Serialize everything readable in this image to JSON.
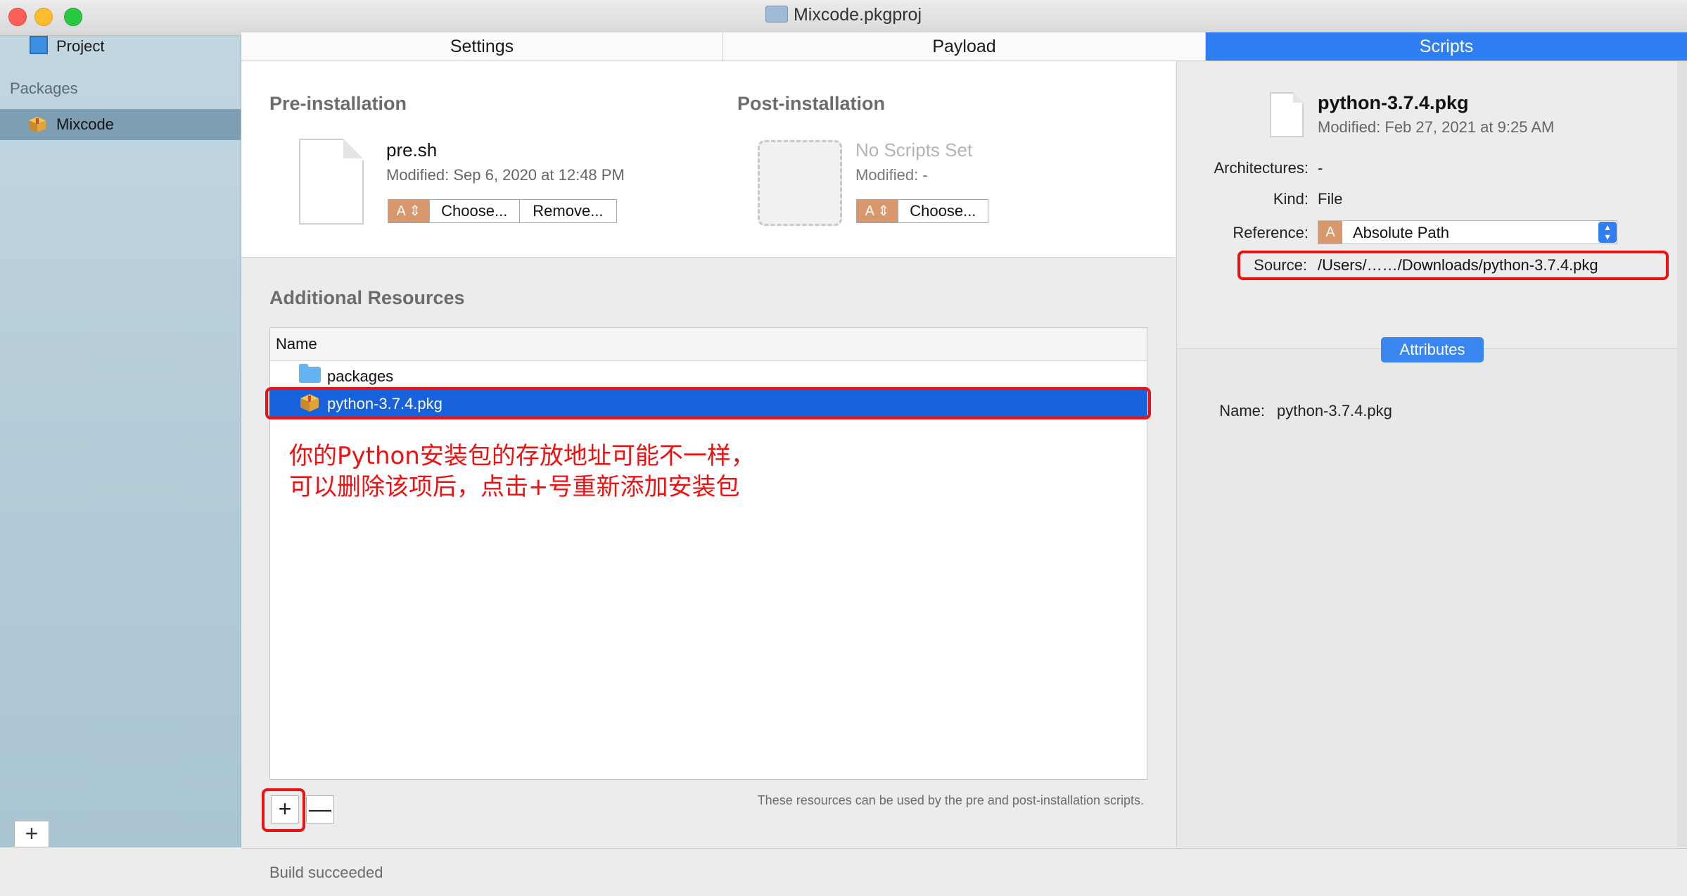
{
  "window": {
    "title": "Mixcode.pkgproj"
  },
  "sidebar": {
    "project_label": "Project",
    "section_label": "Packages",
    "selected_package": "Mixcode",
    "add_button": "+"
  },
  "tabs": [
    {
      "label": "Settings",
      "selected": false
    },
    {
      "label": "Payload",
      "selected": false
    },
    {
      "label": "Scripts",
      "selected": true
    }
  ],
  "pre_installation": {
    "heading": "Pre-installation",
    "file_name": "pre.sh",
    "modified": "Modified:  Sep 6, 2020 at 12:48 PM",
    "path_type_label": "A ⇕",
    "choose_button": "Choose...",
    "remove_button": "Remove..."
  },
  "post_installation": {
    "heading": "Post-installation",
    "file_name": "No Scripts Set",
    "modified": "Modified:  -",
    "path_type_label": "A ⇕",
    "choose_button": "Choose..."
  },
  "additional_resources": {
    "heading": "Additional Resources",
    "column_header": "Name",
    "rows": [
      {
        "name": "packages",
        "icon": "folder-icon",
        "selected": false
      },
      {
        "name": "python-3.7.4.pkg",
        "icon": "package-icon",
        "selected": true
      }
    ],
    "add_button": "+",
    "remove_button": "—",
    "hint": "These resources can be used by the pre and post-installation scripts."
  },
  "annotation": {
    "line1": "你的Python安装包的存放地址可能不一样，",
    "line2": "可以删除该项后，点击+号重新添加安装包",
    "color": "#ee1111"
  },
  "status": {
    "text": "Build succeeded"
  },
  "inspector": {
    "file_name": "python-3.7.4.pkg",
    "modified": "Modified:  Feb 27, 2021 at 9:25 AM",
    "architectures_label": "Architectures:",
    "architectures_value": "-",
    "kind_label": "Kind:",
    "kind_value": "File",
    "reference_label": "Reference:",
    "reference_badge": "A",
    "reference_value": "Absolute Path",
    "source_label": "Source:",
    "source_value": "/Users/……/Downloads/python-3.7.4.pkg",
    "attributes_button": "Attributes",
    "name_label": "Name:",
    "name_value": "python-3.7.4.pkg"
  },
  "colors": {
    "accent": "#2f7ff2",
    "selection": "#1761dc",
    "sidebar_selection": "#7e9fb3",
    "annotation_red": "#ee1111"
  }
}
